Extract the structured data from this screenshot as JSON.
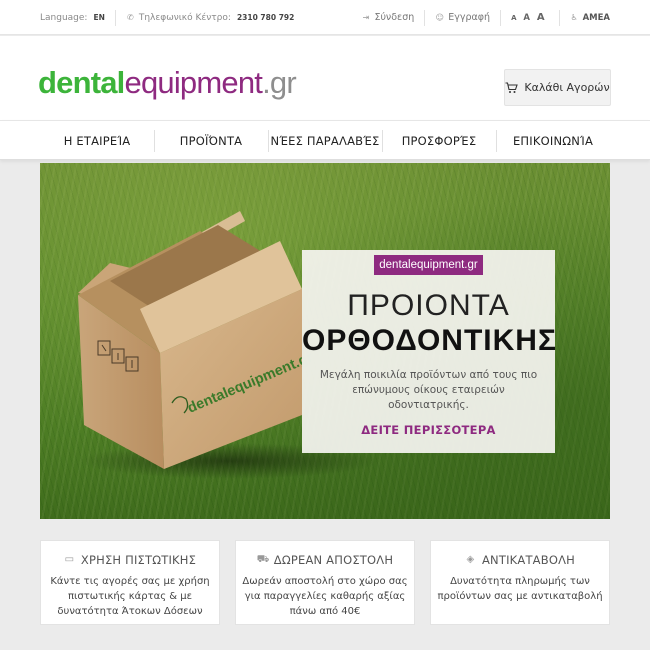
{
  "topbar": {
    "language_label": "Language:",
    "language_value": "EN",
    "phone_label": "Τηλεφωνικό Κέντρο:",
    "phone_value": "2310 780 792",
    "login": "Σύνδεση",
    "register": "Εγγραφή",
    "font_sizes": [
      "A",
      "A",
      "A"
    ],
    "accessibility": "AMEA"
  },
  "header": {
    "logo_part1": "dental",
    "logo_part2": "equipment",
    "logo_part3": ".gr",
    "cart_label": "Καλάθι Αγορών"
  },
  "nav": {
    "items": [
      "Η ΕΤΑΙΡΕΊΑ",
      "ΠΡΟΪΌΝΤΑ",
      "ΝΈΕΣ ΠΑΡΑΛΑΒΈΣ",
      "ΠΡΟΣΦΟΡΈΣ",
      "ΕΠΙΚΟΙΝΩΝΊΑ"
    ]
  },
  "hero": {
    "tag": "dentalequipment.gr",
    "box_logo": "dentalequipment.gr",
    "title_line1": "ΠΡΟΙΟΝΤΑ",
    "title_line2": "ΟΡΘΟΔΟΝΤΙΚΗΣ",
    "description": "Μεγάλη ποικιλία προϊόντων από τους πιο επώνυμους οίκους εταιρειών οδοντιατρικής.",
    "cta": "ΔΕΙΤΕ ΠΕΡΙΣΣΟΤΕΡΑ"
  },
  "features": [
    {
      "icon": "credit-card-icon",
      "title": "ΧΡΗΣΗ ΠΙΣΤΩΤΙΚΗΣ",
      "text": "Κάντε τις αγορές σας με χρήση πιστωτικής κάρτας & με δυνατότητα Άτοκων Δόσεων"
    },
    {
      "icon": "truck-icon",
      "title": "ΔΩΡΕΑΝ ΑΠΟΣΤΟΛΗ",
      "text": "Δωρεάν αποστολή στο χώρο σας για παραγγελίες καθαρής αξίας πάνω από 40€"
    },
    {
      "icon": "tag-icon",
      "title": "ΑΝΤΙΚΑΤΑΒΟΛΗ",
      "text": "Δυνατότητα πληρωμής των προϊόντων σας με αντικαταβολή"
    }
  ],
  "colors": {
    "brand_green": "#3cb43a",
    "brand_purple": "#8e2a80",
    "brand_gray": "#8e8e8e"
  }
}
